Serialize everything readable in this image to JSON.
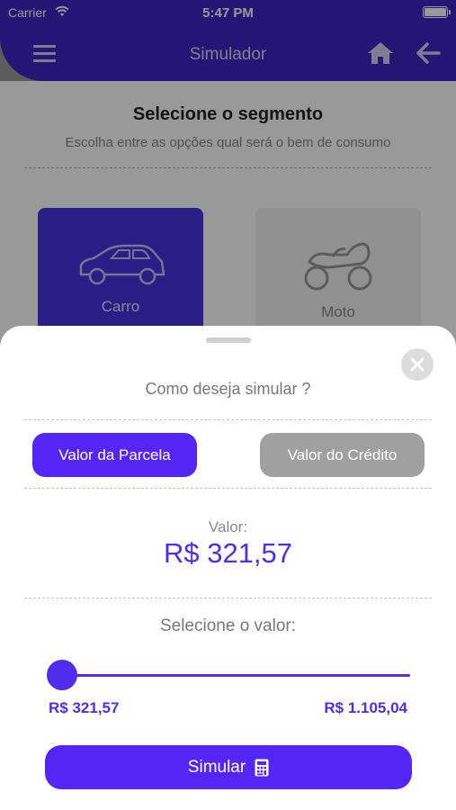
{
  "status_bar": {
    "carrier": "Carrier",
    "time": "5:47 PM",
    "battery_level": 1.0
  },
  "header": {
    "title": "Simulador"
  },
  "page": {
    "title": "Selecione o segmento",
    "subtitle": "Escolha entre as opções qual será o bem de consumo",
    "segments": [
      {
        "label": "Carro",
        "icon": "car-icon",
        "selected": true
      },
      {
        "label": "Moto",
        "icon": "motorcycle-icon",
        "selected": false
      }
    ]
  },
  "sheet": {
    "question": "Como deseja simular ?",
    "modes": [
      {
        "label": "Valor da Parcela",
        "selected": true
      },
      {
        "label": "Valor do Crédito",
        "selected": false
      }
    ],
    "valor_label": "Valor:",
    "valor_amount": "R$ 321,57",
    "select_label": "Selecione o valor:",
    "slider": {
      "min_label": "R$ 321,57",
      "max_label": "R$ 1.105,04",
      "position": 0.0
    },
    "submit_label": "Simular",
    "submit_icon": "calculator-icon"
  },
  "colors": {
    "primary": "#4f2cee",
    "header": "#3f24c4",
    "disabled": "#a0a0a0"
  }
}
